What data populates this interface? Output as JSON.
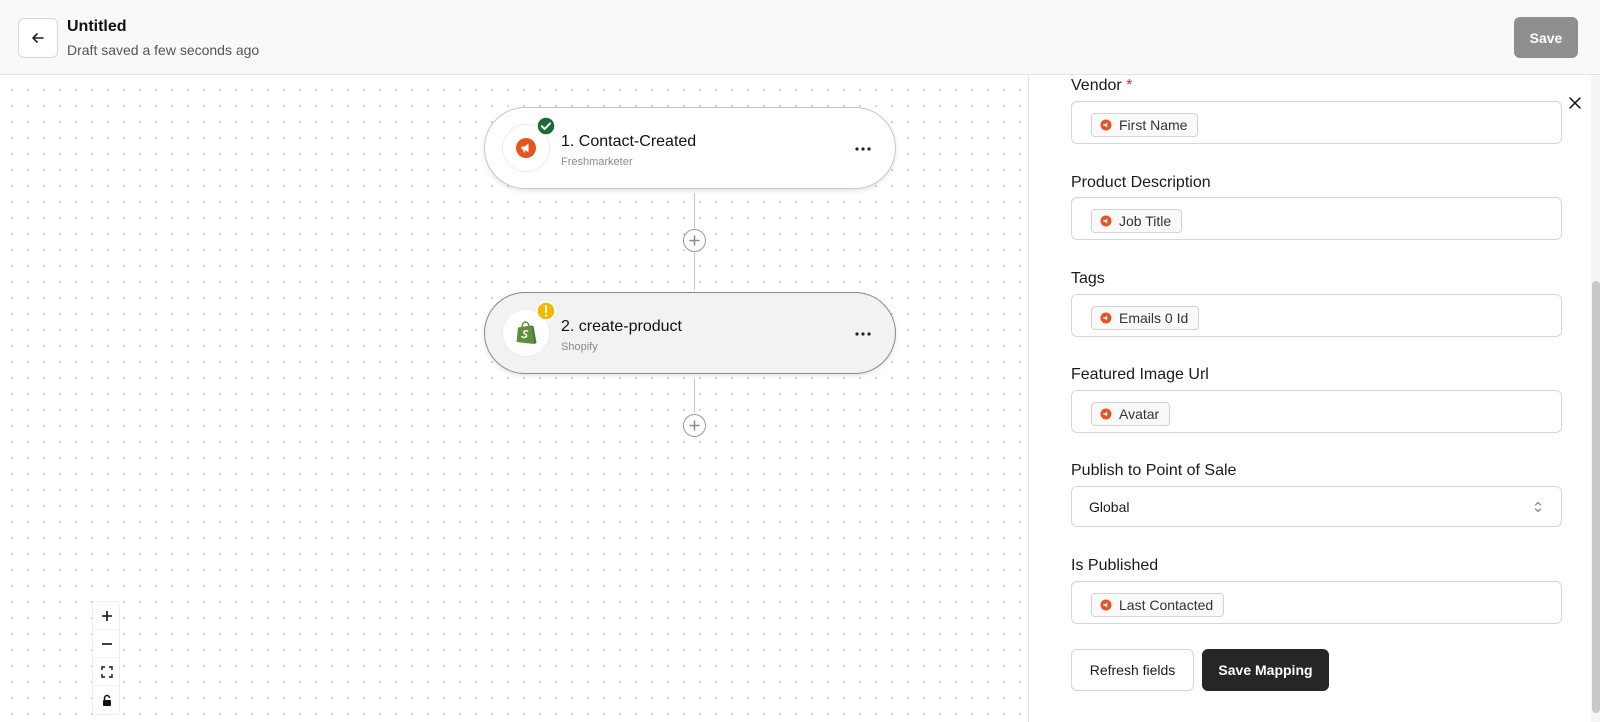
{
  "header": {
    "title": "Untitled",
    "status": "Draft saved a few seconds ago",
    "save_label": "Save"
  },
  "workflow": {
    "nodes": [
      {
        "title": "1. Contact-Created",
        "app": "Freshmarketer",
        "icon": "freshmarketer-icon",
        "state": "success-check-icon"
      },
      {
        "title": "2. create-product",
        "app": "Shopify",
        "icon": "shopify-icon",
        "state": "warning-icon"
      }
    ]
  },
  "canvas_controls": [
    "zoom-in-icon",
    "zoom-out-icon",
    "fit-view-icon",
    "lock-icon"
  ],
  "panel": {
    "fields": [
      {
        "label": "Vendor",
        "required": "*",
        "value": "First Name"
      },
      {
        "label": "Product Description",
        "value": "Job Title"
      },
      {
        "label": "Tags",
        "value": "Emails 0 Id"
      },
      {
        "label": "Featured Image Url",
        "value": "Avatar"
      },
      {
        "label": "Publish to Point of Sale",
        "value": "Global"
      },
      {
        "label": "Is Published",
        "value": "Last Contacted"
      }
    ],
    "refresh_label": "Refresh fields",
    "save_mapping_label": "Save Mapping"
  },
  "colors": {
    "freshmarketer_orange": "#e8541e",
    "shopify_green": "#5e8e3e",
    "success_green": "#1e6b34",
    "warning_yellow": "#f5b800",
    "primary_dark": "#262626",
    "disabled_gray": "#8f8f8f"
  }
}
